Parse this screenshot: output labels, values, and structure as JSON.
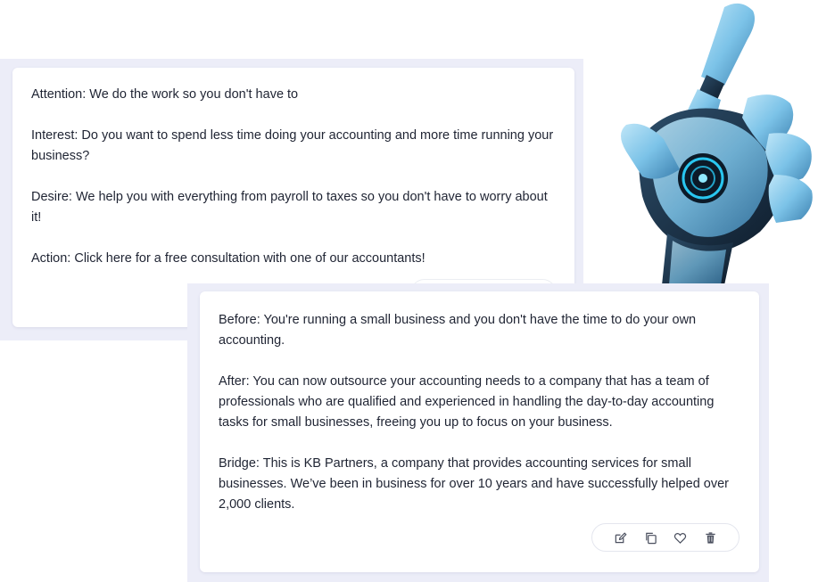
{
  "aida_card": {
    "lines": [
      "Attention: We do the work so you don't have to",
      "Interest: Do you want to spend less time doing your accounting and more time running your business?",
      "Desire: We help you with everything from payroll to taxes so you don't have to worry about it!",
      "Action: Click here for a free consultation with one of our accountants!"
    ]
  },
  "bab_card": {
    "lines": [
      "Before: You're running a small business and you don't have the time to do your own accounting.",
      "After: You can now outsource your accounting needs to a company that has a team of professionals who are qualified and experienced in handling the day-to-day accounting tasks for small businesses, freeing you up to focus on your business.",
      "Bridge: This is KB Partners, a company that provides accounting services for small businesses. We’ve been in business for over 10 years and have successfully helped over 2,000 clients."
    ],
    "toolbar": {
      "icons": [
        "edit-icon",
        "copy-icon",
        "heart-icon",
        "trash-icon"
      ]
    }
  },
  "colors": {
    "panel_bg": "#ecedf8",
    "card_bg": "#ffffff",
    "text": "#1f2433",
    "icon": "#4a4f5e",
    "robot_blue": "#7cc3e8"
  }
}
